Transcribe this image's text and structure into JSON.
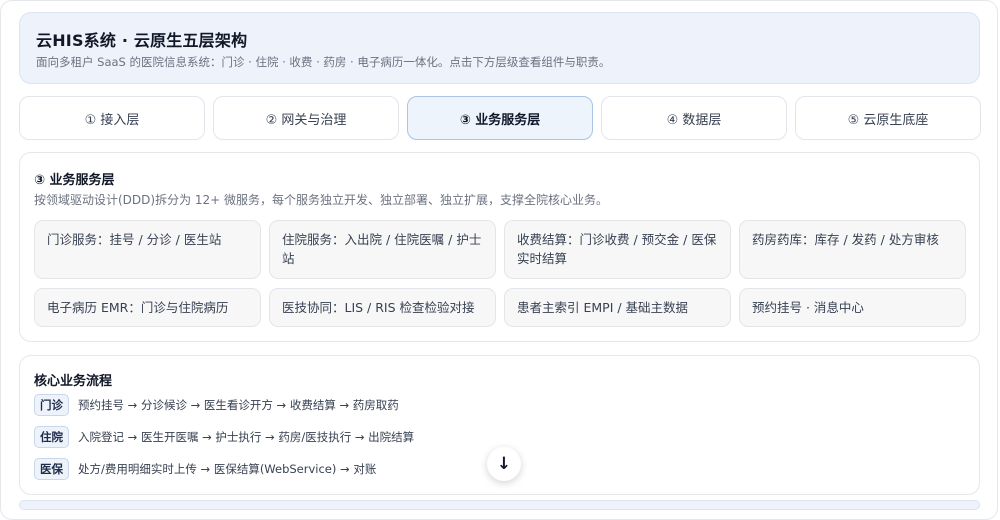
{
  "header": {
    "title": "云HIS系统 · 云原生五层架构",
    "subtitle": "面向多租户 SaaS 的医院信息系统：门诊 · 住院 · 收费 · 药房 · 电子病历一体化。点击下方层级查看组件与职责。"
  },
  "tabs": [
    {
      "label": "① 接入层"
    },
    {
      "label": "② 网关与治理"
    },
    {
      "label": "③ 业务服务层"
    },
    {
      "label": "④ 数据层"
    },
    {
      "label": "⑤ 云原生底座"
    }
  ],
  "active_tab": 2,
  "layer_panel": {
    "title": "③ 业务服务层",
    "description": "按领域驱动设计(DDD)拆分为 12+ 微服务，每个服务独立开发、独立部署、独立扩展，支撑全院核心业务。",
    "services": [
      {
        "line1": "门诊服务：挂号 / 分诊 / 医生站",
        "line2": ""
      },
      {
        "line1": "住院服务：入出院 / 住院医嘱 / 护士",
        "line2": "站"
      },
      {
        "line1": "收费结算：门诊收费 / 预交金 / 医保",
        "line2": "实时结算"
      },
      {
        "line1": "药房药库：库存 / 发药 / 处方审核",
        "line2": ""
      },
      {
        "line1": "电子病历 EMR：门诊与住院病历",
        "line2": ""
      },
      {
        "line1": "医技协同：LIS / RIS 检查检验对接",
        "line2": ""
      },
      {
        "line1": "患者主索引 EMPI / 基础主数据",
        "line2": ""
      },
      {
        "line1": "预约挂号 · 消息中心",
        "line2": ""
      }
    ]
  },
  "core_flow": {
    "title": "核心业务流程",
    "rows": [
      {
        "tag": "门诊",
        "text": "预约挂号 → 分诊候诊 → 医生看诊开方 → 收费结算 → 药房取药"
      },
      {
        "tag": "住院",
        "text": "入院登记 → 医生开医嘱 → 护士执行 → 药房/医技执行 → 出院结算"
      },
      {
        "tag": "医保",
        "text": "处方/费用明细实时上传 → 医保结算(WebService) → 对账"
      }
    ]
  },
  "scroll_button": {
    "icon": "arrow-down-icon",
    "glyph": "↓"
  }
}
